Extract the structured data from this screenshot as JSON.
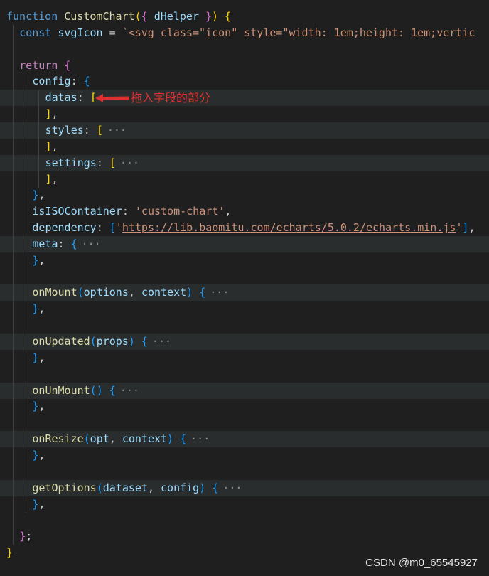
{
  "colors": {
    "background": "#1f1f1f",
    "line_highlight": "#2a2d2e",
    "keyword": "#569cd6",
    "control": "#c586c0",
    "function": "#dcdcaa",
    "variable": "#9cdcfe",
    "string": "#ce9178",
    "bracket_gold": "#ffd700",
    "bracket_violet": "#da70d6",
    "bracket_blue": "#179fff",
    "default": "#cccccc",
    "annotation": "#e02f2f"
  },
  "code": {
    "lines": [
      {
        "indent": 0,
        "tokens": [
          {
            "t": "function",
            "c": "keyword"
          },
          {
            "t": " "
          },
          {
            "t": "CustomChart",
            "c": "function"
          },
          {
            "t": "(",
            "c": "bracket_gold"
          },
          {
            "t": "{",
            "c": "bracket_violet"
          },
          {
            "t": " "
          },
          {
            "t": "dHelper",
            "c": "variable"
          },
          {
            "t": " "
          },
          {
            "t": "}",
            "c": "bracket_violet"
          },
          {
            "t": ")",
            "c": "bracket_gold"
          },
          {
            "t": " "
          },
          {
            "t": "{",
            "c": "bracket_gold"
          }
        ]
      },
      {
        "indent": 1,
        "tokens": [
          {
            "t": "const",
            "c": "keyword"
          },
          {
            "t": " "
          },
          {
            "t": "svgIcon",
            "c": "variable"
          },
          {
            "t": " = "
          },
          {
            "t": "`<svg class=\"icon\" style=\"width: 1em;height: 1em;vertic",
            "c": "string"
          }
        ]
      },
      {
        "indent": 1,
        "tokens": []
      },
      {
        "indent": 1,
        "tokens": [
          {
            "t": "return",
            "c": "control"
          },
          {
            "t": " "
          },
          {
            "t": "{",
            "c": "bracket_violet"
          }
        ]
      },
      {
        "indent": 2,
        "tokens": [
          {
            "t": "config",
            "c": "variable"
          },
          {
            "t": ": "
          },
          {
            "t": "{",
            "c": "bracket_blue"
          }
        ]
      },
      {
        "indent": 3,
        "hl": true,
        "tokens": [
          {
            "t": "datas",
            "c": "variable"
          },
          {
            "t": ": "
          },
          {
            "t": "[",
            "c": "bracket_gold"
          }
        ]
      },
      {
        "indent": 3,
        "tokens": [
          {
            "t": "]",
            "c": "bracket_gold"
          },
          {
            "t": ","
          }
        ]
      },
      {
        "indent": 3,
        "hl": true,
        "tokens": [
          {
            "t": "styles",
            "c": "variable"
          },
          {
            "t": ": "
          },
          {
            "t": "[",
            "c": "bracket_gold"
          },
          {
            "t": "···",
            "fold": true
          }
        ]
      },
      {
        "indent": 3,
        "tokens": [
          {
            "t": "]",
            "c": "bracket_gold"
          },
          {
            "t": ","
          }
        ]
      },
      {
        "indent": 3,
        "hl": true,
        "tokens": [
          {
            "t": "settings",
            "c": "variable"
          },
          {
            "t": ": "
          },
          {
            "t": "[",
            "c": "bracket_gold"
          },
          {
            "t": "···",
            "fold": true
          }
        ]
      },
      {
        "indent": 3,
        "tokens": [
          {
            "t": "]",
            "c": "bracket_gold"
          },
          {
            "t": ","
          }
        ]
      },
      {
        "indent": 2,
        "tokens": [
          {
            "t": "}",
            "c": "bracket_blue"
          },
          {
            "t": ","
          }
        ]
      },
      {
        "indent": 2,
        "tokens": [
          {
            "t": "isISOContainer",
            "c": "variable"
          },
          {
            "t": ": "
          },
          {
            "t": "'custom-chart'",
            "c": "string"
          },
          {
            "t": ","
          }
        ]
      },
      {
        "indent": 2,
        "tokens": [
          {
            "t": "dependency",
            "c": "variable"
          },
          {
            "t": ": "
          },
          {
            "t": "[",
            "c": "bracket_blue"
          },
          {
            "t": "'",
            "c": "string"
          },
          {
            "t": "https://lib.baomitu.com/echarts/5.0.2/echarts.min.js",
            "c": "string",
            "u": true
          },
          {
            "t": "'",
            "c": "string"
          },
          {
            "t": "]",
            "c": "bracket_blue"
          },
          {
            "t": ","
          }
        ]
      },
      {
        "indent": 2,
        "hl": true,
        "tokens": [
          {
            "t": "meta",
            "c": "variable"
          },
          {
            "t": ": "
          },
          {
            "t": "{",
            "c": "bracket_blue"
          },
          {
            "t": "···",
            "fold": true
          }
        ]
      },
      {
        "indent": 2,
        "tokens": [
          {
            "t": "}",
            "c": "bracket_blue"
          },
          {
            "t": ","
          }
        ]
      },
      {
        "indent": 2,
        "tokens": []
      },
      {
        "indent": 2,
        "hl": true,
        "tokens": [
          {
            "t": "onMount",
            "c": "function"
          },
          {
            "t": "(",
            "c": "bracket_blue"
          },
          {
            "t": "options",
            "c": "variable"
          },
          {
            "t": ", "
          },
          {
            "t": "context",
            "c": "variable"
          },
          {
            "t": ")",
            "c": "bracket_blue"
          },
          {
            "t": " "
          },
          {
            "t": "{",
            "c": "bracket_blue"
          },
          {
            "t": "···",
            "fold": true
          }
        ]
      },
      {
        "indent": 2,
        "tokens": [
          {
            "t": "}",
            "c": "bracket_blue"
          },
          {
            "t": ","
          }
        ]
      },
      {
        "indent": 2,
        "tokens": []
      },
      {
        "indent": 2,
        "hl": true,
        "tokens": [
          {
            "t": "onUpdated",
            "c": "function"
          },
          {
            "t": "(",
            "c": "bracket_blue"
          },
          {
            "t": "props",
            "c": "variable"
          },
          {
            "t": ")",
            "c": "bracket_blue"
          },
          {
            "t": " "
          },
          {
            "t": "{",
            "c": "bracket_blue"
          },
          {
            "t": "···",
            "fold": true
          }
        ]
      },
      {
        "indent": 2,
        "tokens": [
          {
            "t": "}",
            "c": "bracket_blue"
          },
          {
            "t": ","
          }
        ]
      },
      {
        "indent": 2,
        "tokens": []
      },
      {
        "indent": 2,
        "hl": true,
        "tokens": [
          {
            "t": "onUnMount",
            "c": "function"
          },
          {
            "t": "()",
            "c": "bracket_blue"
          },
          {
            "t": " "
          },
          {
            "t": "{",
            "c": "bracket_blue"
          },
          {
            "t": "···",
            "fold": true
          }
        ]
      },
      {
        "indent": 2,
        "tokens": [
          {
            "t": "}",
            "c": "bracket_blue"
          },
          {
            "t": ","
          }
        ]
      },
      {
        "indent": 2,
        "tokens": []
      },
      {
        "indent": 2,
        "hl": true,
        "tokens": [
          {
            "t": "onResize",
            "c": "function"
          },
          {
            "t": "(",
            "c": "bracket_blue"
          },
          {
            "t": "opt",
            "c": "variable"
          },
          {
            "t": ", "
          },
          {
            "t": "context",
            "c": "variable"
          },
          {
            "t": ")",
            "c": "bracket_blue"
          },
          {
            "t": " "
          },
          {
            "t": "{",
            "c": "bracket_blue"
          },
          {
            "t": "···",
            "fold": true
          }
        ]
      },
      {
        "indent": 2,
        "tokens": [
          {
            "t": "}",
            "c": "bracket_blue"
          },
          {
            "t": ","
          }
        ]
      },
      {
        "indent": 2,
        "tokens": []
      },
      {
        "indent": 2,
        "hl": true,
        "tokens": [
          {
            "t": "getOptions",
            "c": "function"
          },
          {
            "t": "(",
            "c": "bracket_blue"
          },
          {
            "t": "dataset",
            "c": "variable"
          },
          {
            "t": ", "
          },
          {
            "t": "config",
            "c": "variable"
          },
          {
            "t": ")",
            "c": "bracket_blue"
          },
          {
            "t": " "
          },
          {
            "t": "{",
            "c": "bracket_blue"
          },
          {
            "t": "···",
            "fold": true
          }
        ]
      },
      {
        "indent": 2,
        "tokens": [
          {
            "t": "}",
            "c": "bracket_blue"
          },
          {
            "t": ","
          }
        ]
      },
      {
        "indent": 1,
        "tokens": []
      },
      {
        "indent": 1,
        "tokens": [
          {
            "t": "}",
            "c": "bracket_violet"
          },
          {
            "t": ";"
          }
        ]
      },
      {
        "indent": 0,
        "tokens": [
          {
            "t": "}",
            "c": "bracket_gold"
          }
        ]
      }
    ]
  },
  "annotation": {
    "text": "拖入字段的部分"
  },
  "watermark": "CSDN @m0_65545927"
}
